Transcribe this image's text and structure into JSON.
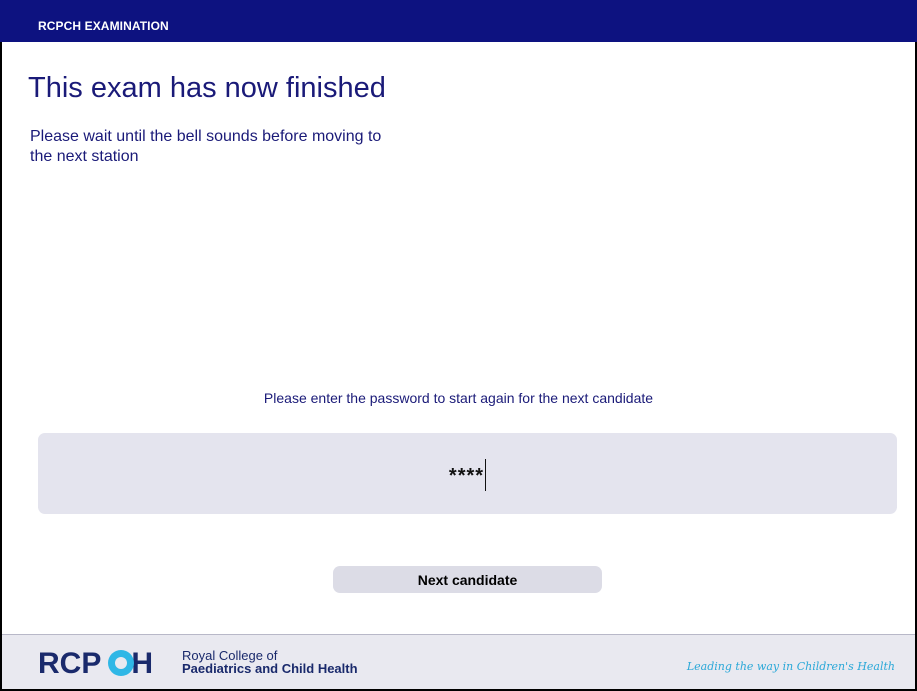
{
  "header": {
    "title": "RCPCH EXAMINATION"
  },
  "main": {
    "heading": "This exam has now finished",
    "subtext": "Please wait until the bell sounds before moving to the next station",
    "password_prompt": "Please enter the password to start again for the next candidate",
    "password_value": "****",
    "next_button_label": "Next candidate"
  },
  "footer": {
    "logo_text_1": "RCP",
    "logo_text_2": "H",
    "org_name_line1": "Royal College of",
    "org_name_line2": "Paediatrics and Child Health",
    "tagline": "Leading the way in Children's Health"
  },
  "colors": {
    "header_bg": "#0d1280",
    "text_primary": "#1a1a78",
    "input_bg": "#e4e4ee",
    "logo_accent": "#2fb7e6",
    "tagline": "#2aa8d8"
  }
}
